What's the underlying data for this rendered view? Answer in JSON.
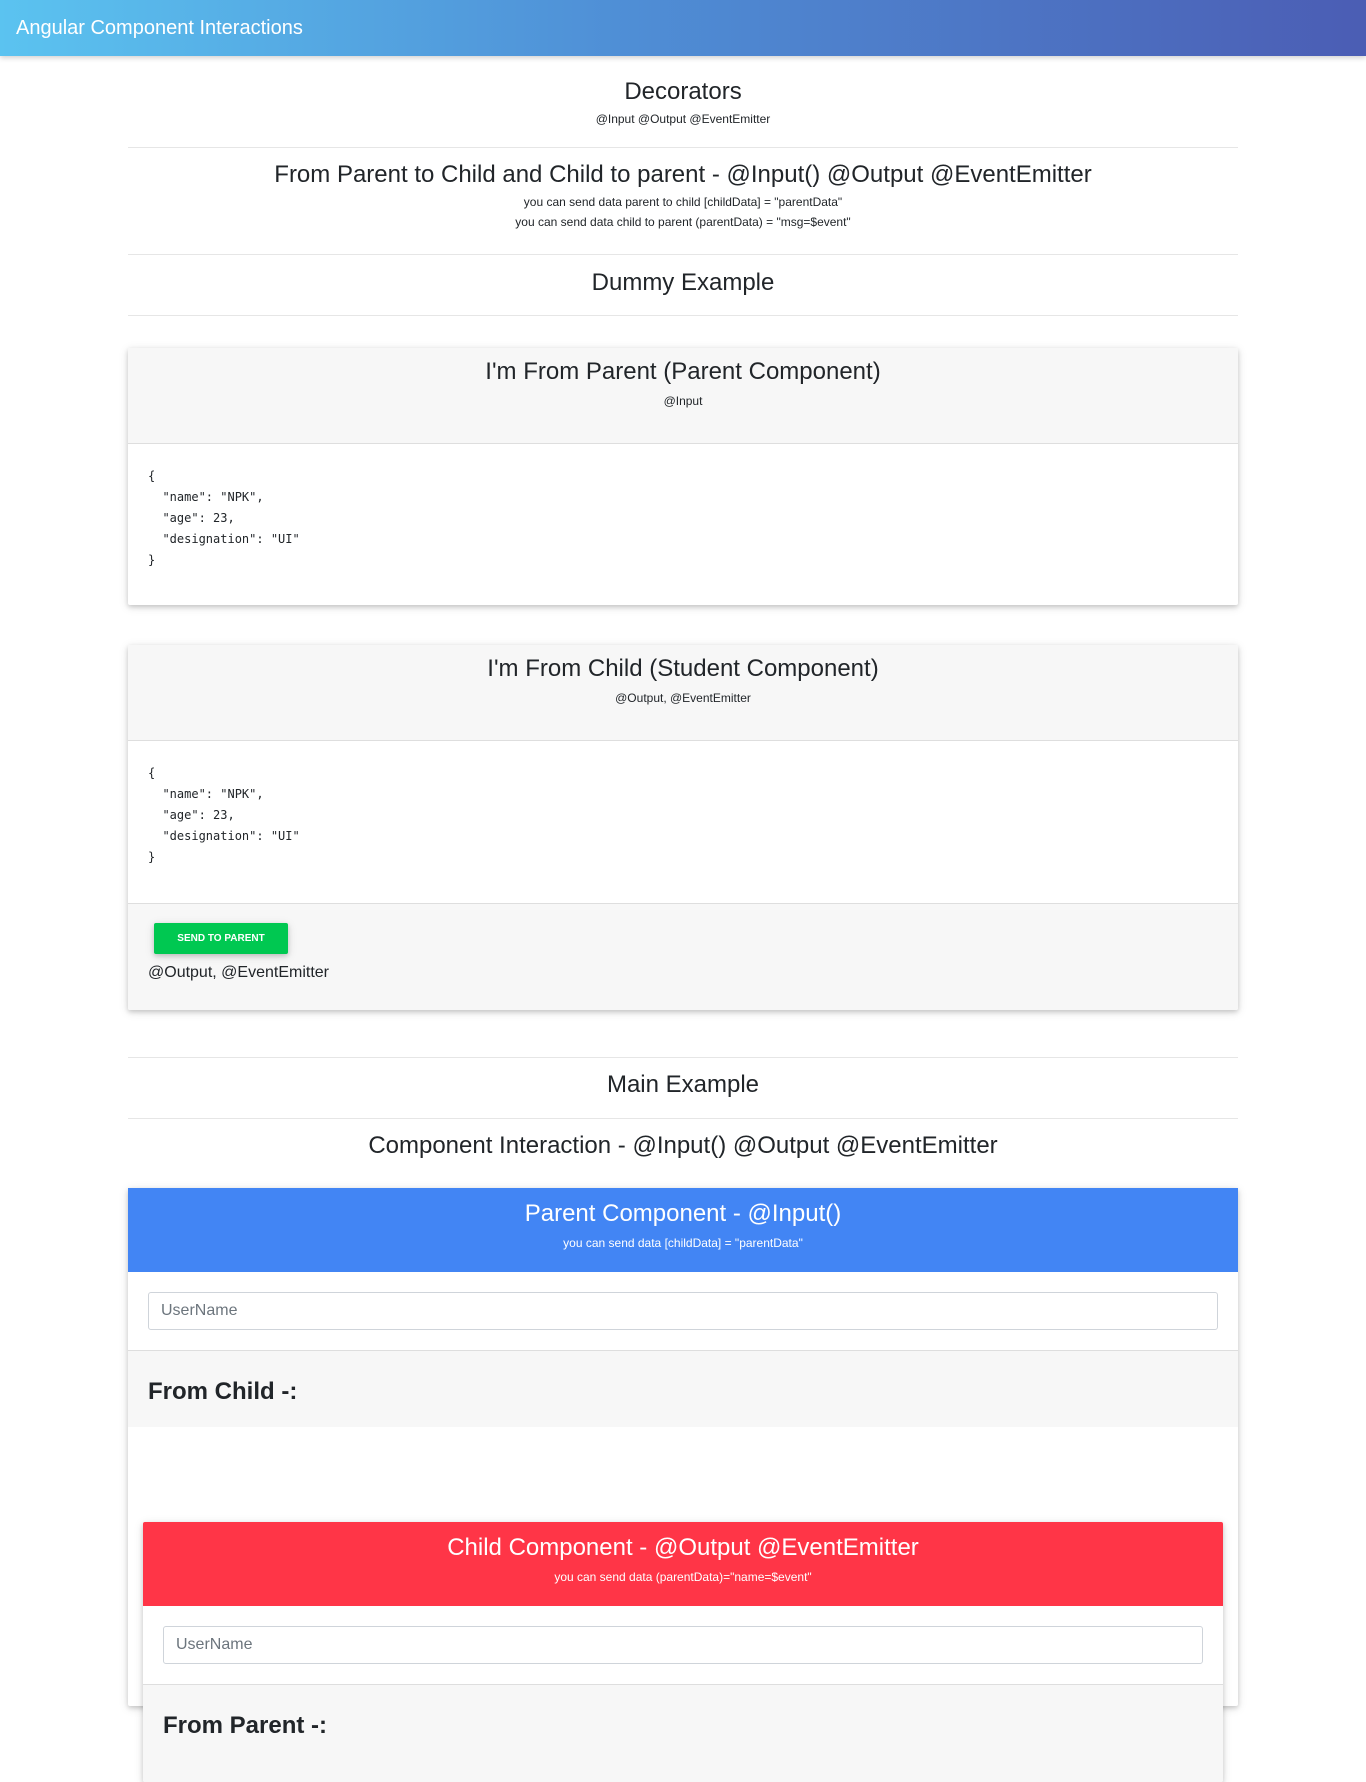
{
  "navbar": {
    "title": "Angular Component Interactions"
  },
  "decorators": {
    "title": "Decorators",
    "subtitle": "@Input @Output @EventEmitter"
  },
  "parent_child": {
    "title": "From Parent to Child and Child to parent - @Input() @Output @EventEmitter",
    "line1": "you can send data parent to child [childData] = \"parentData\"",
    "line2": "you can send data child to parent (parentData) = \"msg=$event\""
  },
  "dummy": {
    "title": "Dummy Example"
  },
  "parent_card": {
    "title": "I'm From Parent (Parent Component)",
    "subtitle": "@Input",
    "json": "{\n  \"name\": \"NPK\",\n  \"age\": 23,\n  \"designation\": \"UI\"\n}"
  },
  "child_card": {
    "title": "I'm From Child (Student Component)",
    "subtitle": "@Output, @EventEmitter",
    "json": "{\n  \"name\": \"NPK\",\n  \"age\": 23,\n  \"designation\": \"UI\"\n}",
    "button_label": "Send to Parent",
    "footer_text": "@Output, @EventEmitter"
  },
  "main": {
    "title": "Main Example",
    "subtitle": "Component Interaction - @Input() @Output @EventEmitter"
  },
  "parent_component": {
    "title": "Parent Component - @Input()",
    "subtitle": "you can send data [childData] = \"parentData\"",
    "input_placeholder": "UserName",
    "from_label": "From Child -:"
  },
  "child_component": {
    "title": "Child Component - @Output @EventEmitter",
    "subtitle": "you can send data (parentData)=\"name=$event\"",
    "input_placeholder": "UserName",
    "from_label": "From Parent -:"
  },
  "colors": {
    "parent_header": "#4285f4",
    "child_header": "#ff3547",
    "send_button": "#00c851"
  }
}
